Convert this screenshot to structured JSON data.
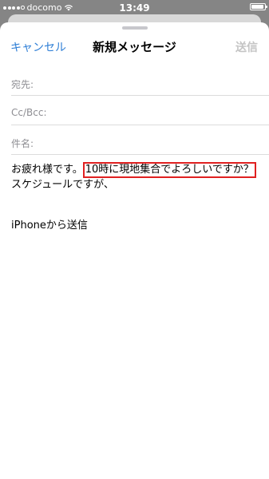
{
  "status_bar": {
    "carrier": "docomo",
    "time": "13:49",
    "signal_bars_filled": 4,
    "signal_bars_total": 5
  },
  "nav": {
    "cancel_label": "キャンセル",
    "title": "新規メッセージ",
    "send_label": "送信"
  },
  "fields": {
    "to_label": "宛先:",
    "cc_label": "Cc/Bcc:",
    "subject_label": "件名:"
  },
  "body": {
    "line1_prefix": "お疲れ様です。",
    "line1_highlight": "10時に現地集合でよろしいですか？",
    "line2": "スケジュールですが、",
    "signature": "iPhoneから送信"
  },
  "colors": {
    "accent": "#2f7fd6",
    "send_disabled": "#c4c4c4",
    "highlight_border": "#e02020"
  }
}
